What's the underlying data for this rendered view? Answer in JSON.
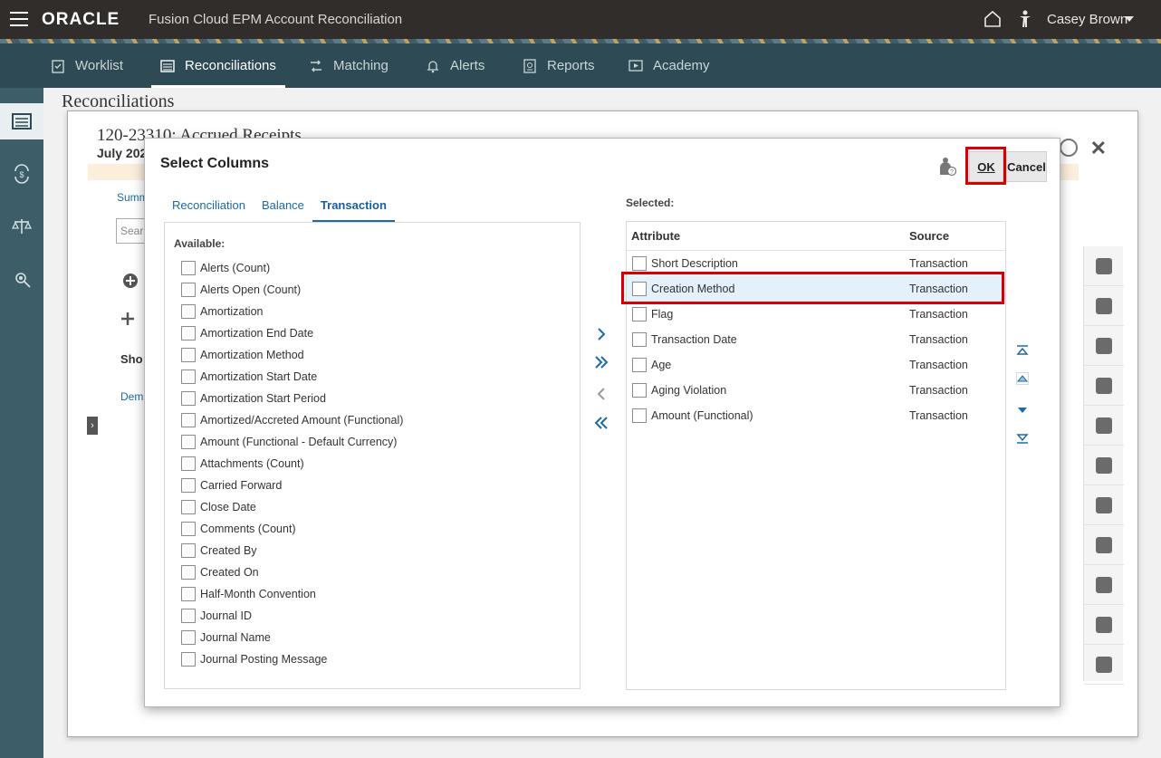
{
  "header": {
    "logo": "ORACLE",
    "app_title": "Fusion Cloud EPM Account Reconciliation",
    "user": "Casey Brown"
  },
  "nav": {
    "tabs": [
      {
        "label": "Worklist",
        "icon": "worklist-icon"
      },
      {
        "label": "Reconciliations",
        "icon": "reconciliations-icon",
        "active": true
      },
      {
        "label": "Matching",
        "icon": "matching-icon"
      },
      {
        "label": "Alerts",
        "icon": "bell-icon"
      },
      {
        "label": "Reports",
        "icon": "reports-icon"
      },
      {
        "label": "Academy",
        "icon": "academy-icon"
      }
    ]
  },
  "background": {
    "page_title": "Reconciliations",
    "recon_title": "120-23310: Accrued Receipts",
    "recon_period": "July 202",
    "summary_link": "Summ",
    "search_placeholder": "Sear",
    "short_label": "Sho",
    "demo_link": "Dem"
  },
  "dialog": {
    "title": "Select Columns",
    "ok_label": "OK",
    "cancel_label": "Cancel",
    "tabs": [
      "Reconciliation",
      "Balance",
      "Transaction"
    ],
    "active_tab": "Transaction",
    "available_label": "Available:",
    "available": [
      "Alerts (Count)",
      "Alerts Open (Count)",
      "Amortization",
      "Amortization End Date",
      "Amortization Method",
      "Amortization Start Date",
      "Amortization Start Period",
      "Amortized/Accreted Amount (Functional)",
      "Amount (Functional - Default Currency)",
      "Attachments (Count)",
      "Carried Forward",
      "Close Date",
      "Comments (Count)",
      "Created By",
      "Created On",
      "Half-Month Convention",
      "Journal ID",
      "Journal Name",
      "Journal Posting Message"
    ],
    "selected_label": "Selected:",
    "selected_headers": {
      "attribute": "Attribute",
      "source": "Source"
    },
    "selected": [
      {
        "attribute": "Short Description",
        "source": "Transaction"
      },
      {
        "attribute": "Creation Method",
        "source": "Transaction",
        "highlighted": true
      },
      {
        "attribute": "Flag",
        "source": "Transaction"
      },
      {
        "attribute": "Transaction Date",
        "source": "Transaction"
      },
      {
        "attribute": "Age",
        "source": "Transaction"
      },
      {
        "attribute": "Aging Violation",
        "source": "Transaction"
      },
      {
        "attribute": "Amount (Functional)",
        "source": "Transaction"
      }
    ]
  },
  "colors": {
    "header_bg": "#312d2a",
    "nav_bg": "#2e4a55",
    "rail_bg": "#3d5d69",
    "link": "#1b6aa5",
    "highlight_red": "#d60000",
    "selected_row": "#e4f0fa"
  }
}
